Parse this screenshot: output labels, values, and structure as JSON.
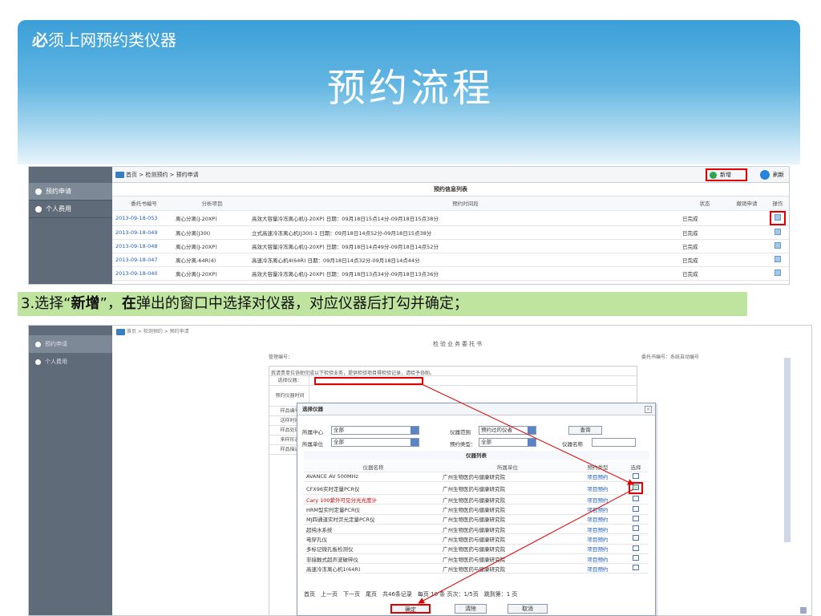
{
  "slide": {
    "subtitle_bold": "必",
    "subtitle_rest": "须上网预约类仪器",
    "title": "预约流程",
    "caption_pre": "3.选择“",
    "caption_b1": "新增",
    "caption_mid": "”，",
    "caption_b2": "在",
    "caption_post": "弹出的窗口中选择对仪器，对应仪器后打勾并确定；"
  },
  "shot1": {
    "sidebar": [
      "预约申请",
      "个人费用"
    ],
    "breadcrumb": "首页 > 检测预约 > 预约申请",
    "new_label": "新增",
    "refresh_label": "刷新",
    "table_title": "预约信息列表",
    "headers": [
      "委托书编号",
      "分析项目",
      "预约时间段",
      "状态",
      "撤销申请",
      "操作"
    ],
    "rows": [
      [
        "2013-09-18-053",
        "离心分离(J-20XP)",
        "高效大容量冷冻离心机(J-20XP) 日期：09月18日15点14分-09月18日15点38分",
        "已完成"
      ],
      [
        "2013-09-18-049",
        "离心分离(J30I)",
        "立式高速冷冻离心机(J30I)-1 日期：09月18日14点52分-09月18日15点38分",
        "已完成"
      ],
      [
        "2013-09-18-048",
        "离心分离(J-20XP)",
        "高效大容量冷冻离心机(J-20XP) 日期：09月18日14点49分-09月18日14点52分",
        "已完成"
      ],
      [
        "2013-09-18-047",
        "离心分离-64R(4)",
        "高速冷冻离心机4(64R) 日期：09月18日14点32分-09月18日14点44分",
        "已完成"
      ],
      [
        "2013-09-18-040",
        "离心分离(J-20XP)",
        "高效大容量冷冻离心机(J-20XP) 日期：09月18日13点34分-09月18日13点36分",
        "已完成"
      ]
    ]
  },
  "shot2": {
    "sidebar": [
      "预约申请",
      "个人费用"
    ],
    "breadcrumb": "首页 > 检测预约 > 预约申请",
    "form_head": "检验业务委托书",
    "mgr_no": "管理编号：",
    "ent_no": "委托书编号：系统自动编号",
    "note": "我请贵单位协助完成以下检验业务，提供检验项目得检验记录，请给予协助。",
    "rows": [
      "选择仪器：",
      "预约仪器时间",
      "样品编号",
      "送样时间",
      "样品处理",
      "来样形态",
      "样品描述"
    ],
    "dialog": {
      "title": "选择仪器",
      "center_label": "所属中心",
      "center_value": "全部",
      "range_label": "仪器范围",
      "range_value": "预约过的仪者",
      "query_label": "查询",
      "unit_label": "所属单位",
      "unit_value": "全部",
      "type_label": "预约类型：",
      "type_value": "全部",
      "name_label": "仪器名称",
      "list_title": "仪器列表",
      "headers": [
        "仪器名称",
        "所属单位",
        "预约类型",
        "选择"
      ],
      "instruments": [
        {
          "name": "AVANCE AV 500MHz",
          "unit": "广州生物医药与健康研究院",
          "type": "项目预约",
          "checked": false,
          "red": false
        },
        {
          "name": "CFX96实时定量PCR仪",
          "unit": "广州生物医药与健康研究院",
          "type": "项目预约",
          "checked": true,
          "red": false
        },
        {
          "name": "Cary 100紫外可见分光光度计",
          "unit": "广州生物医药与健康研究院",
          "type": "项目预约",
          "checked": false,
          "red": true
        },
        {
          "name": "HRM型实时定量PCR仪",
          "unit": "广州生物医药与健康研究院",
          "type": "项目预约",
          "checked": false,
          "red": false
        },
        {
          "name": "MJ四通道实时荧光定量PCR仪",
          "unit": "广州生物医药与健康研究院",
          "type": "项目预约",
          "checked": false,
          "red": false
        },
        {
          "name": "超纯水系统",
          "unit": "广州生物医药与健康研究院",
          "type": "项目预约",
          "checked": false,
          "red": false
        },
        {
          "name": "电穿孔仪",
          "unit": "广州生物医药与健康研究院",
          "type": "项目预约",
          "checked": false,
          "red": false
        },
        {
          "name": "多标记微孔板检测仪",
          "unit": "广州生物医药与健康研究院",
          "type": "项目预约",
          "checked": false,
          "red": false
        },
        {
          "name": "非接触式超声波破碎仪",
          "unit": "广州生物医药与健康研究院",
          "type": "项目预约",
          "checked": false,
          "red": false
        },
        {
          "name": "高速冷冻离心机1(64R)",
          "unit": "广州生物医药与健康研究院",
          "type": "项目预约",
          "checked": false,
          "red": false
        }
      ],
      "pager": "首页　上一页　下一页　尾页　共46条记录　每页 10 条 页次：1/5页　跳到第：1 页",
      "ok_label": "确定",
      "clear_label": "清除",
      "cancel_label": "取消"
    }
  },
  "colors": {
    "banner": "#3a9fd8",
    "highlight": "#e00000",
    "caption_bg": "#bfe49f",
    "sidebar": "#5f6b79"
  }
}
